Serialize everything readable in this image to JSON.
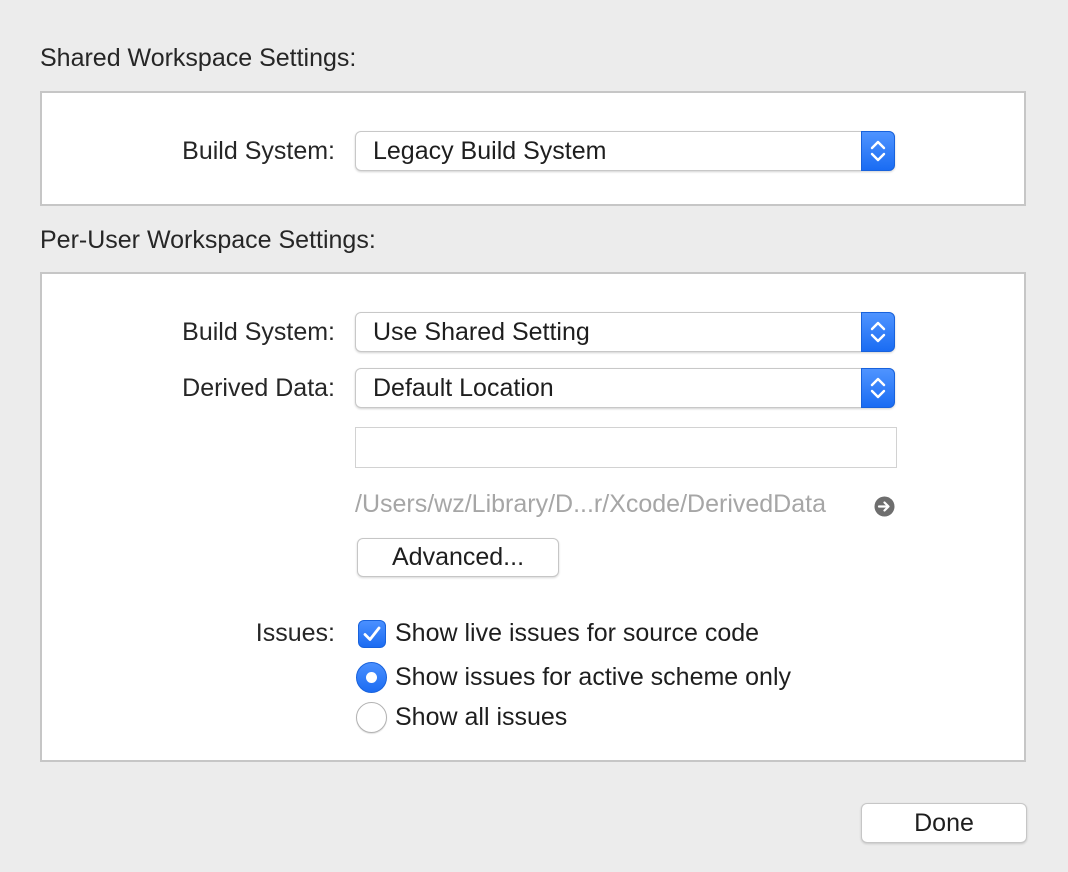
{
  "shared": {
    "title": "Shared Workspace Settings:",
    "build_system_label": "Build System:",
    "build_system_value": "Legacy Build System"
  },
  "per_user": {
    "title": "Per-User Workspace Settings:",
    "build_system_label": "Build System:",
    "build_system_value": "Use Shared Setting",
    "derived_data_label": "Derived Data:",
    "derived_data_value": "Default Location",
    "custom_path_value": "",
    "derived_data_path": "/Users/wz/Library/D...r/Xcode/DerivedData",
    "advanced_label": "Advanced...",
    "issues_label": "Issues:",
    "live_issues_label": "Show live issues for source code",
    "live_issues_checked": true,
    "scope_options": [
      {
        "label": "Show issues for active scheme only",
        "selected": true
      },
      {
        "label": "Show all issues",
        "selected": false
      }
    ]
  },
  "footer": {
    "done_label": "Done"
  },
  "colors": {
    "accent": "#1a6cf3",
    "window_background": "#ececec",
    "disabled_text": "#a6a6a6"
  },
  "icons": {
    "popup_arrows": "chevron-up-down-icon",
    "reveal_arrow": "reveal-in-finder-arrow-icon",
    "checkmark": "checkmark-icon"
  }
}
